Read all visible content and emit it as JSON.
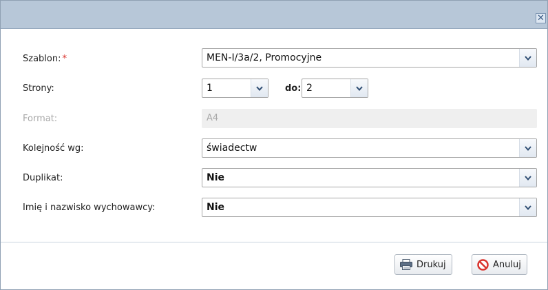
{
  "dialog": {
    "close_glyph": "✕"
  },
  "form": {
    "template": {
      "label": "Szablon:",
      "required_mark": "*",
      "value": "MEN-I/3a/2, Promocyjne"
    },
    "pages": {
      "label": "Strony:",
      "from_value": "1",
      "to_label": "do:",
      "to_value": "2"
    },
    "format": {
      "label": "Format:",
      "value": "A4"
    },
    "order": {
      "label": "Kolejność wg:",
      "value": "świadectw"
    },
    "duplicate": {
      "label": "Duplikat:",
      "value": "Nie"
    },
    "teacher_name": {
      "label": "Imię i nazwisko wychowawcy:",
      "value": "Nie"
    }
  },
  "footer": {
    "print_label": "Drukuj",
    "cancel_label": "Anuluj"
  },
  "colors": {
    "titlebar": "#b7c7d8",
    "required": "#d9322c",
    "cancel_icon": "#d9322c"
  },
  "icons": {
    "close": "close-icon",
    "dropdown": "chevron-down-icon",
    "print": "printer-icon",
    "cancel": "cancel-icon"
  }
}
